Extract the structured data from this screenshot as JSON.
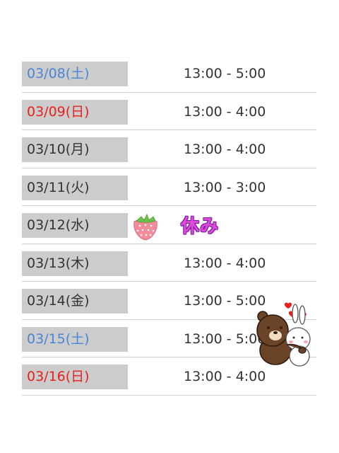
{
  "schedule": [
    {
      "date": "03/08(土)",
      "time": "13:00 - 5:00",
      "day_type": "sat"
    },
    {
      "date": "03/09(日)",
      "time": "13:00 - 4:00",
      "day_type": "sun"
    },
    {
      "date": "03/10(月)",
      "time": "13:00 - 4:00",
      "day_type": "weekday"
    },
    {
      "date": "03/11(火)",
      "time": "13:00 - 3:00",
      "day_type": "weekday"
    },
    {
      "date": "03/12(水)",
      "time": "休み",
      "day_type": "weekday"
    },
    {
      "date": "03/13(木)",
      "time": "13:00 - 4:00",
      "day_type": "weekday"
    },
    {
      "date": "03/14(金)",
      "time": "13:00 - 5:00",
      "day_type": "weekday"
    },
    {
      "date": "03/15(土)",
      "time": "13:00 - 5:00",
      "day_type": "sat"
    },
    {
      "date": "03/16(日)",
      "time": "13:00 - 4:00",
      "day_type": "sun"
    }
  ],
  "colors": {
    "saturday": "#4a86d6",
    "sunday": "#e8201c",
    "weekday": "#333333",
    "date_background": "#cccccc",
    "holiday_text": "#e04ad8"
  },
  "icons": {
    "holiday_decoration": "strawberry-icon",
    "corner_sticker": "bear-and-bunny-hug-sticker"
  }
}
